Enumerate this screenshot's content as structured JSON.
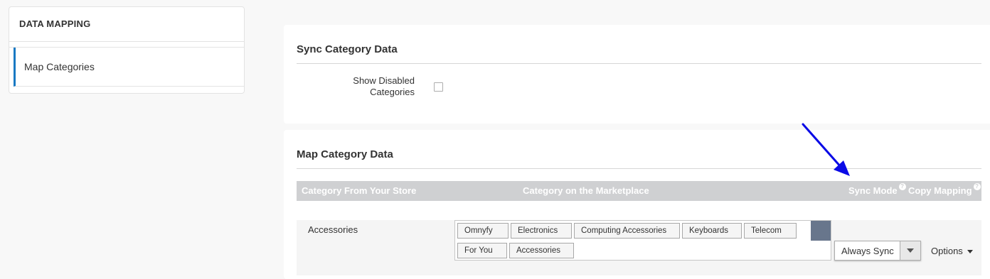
{
  "sidebar": {
    "title": "DATA MAPPING",
    "items": [
      {
        "label": "Map Categories"
      }
    ]
  },
  "sync_panel": {
    "title": "Sync Category Data",
    "show_disabled_label": "Show Disabled Categories",
    "show_disabled_checked": false
  },
  "map_panel": {
    "title": "Map Category Data",
    "columns": {
      "store": "Category From Your Store",
      "marketplace": "Category on the Marketplace",
      "sync_mode": "Sync Mode",
      "copy_mapping": "Copy Mapping"
    },
    "help_glyph": "?",
    "rows": [
      {
        "store_category": "Accessories",
        "marketplace_path": [
          "Omnyfy",
          "Electronics",
          "Computing Accessories",
          "Keyboards",
          "Telecom",
          "For You",
          "Accessories"
        ],
        "sync_mode": "Always Sync",
        "options_label": "Options"
      }
    ]
  },
  "colors": {
    "accent": "#1979c3",
    "header_bg": "#cfd0d2",
    "add_button": "#68768c",
    "annotation_arrow": "#0a0ae6"
  }
}
